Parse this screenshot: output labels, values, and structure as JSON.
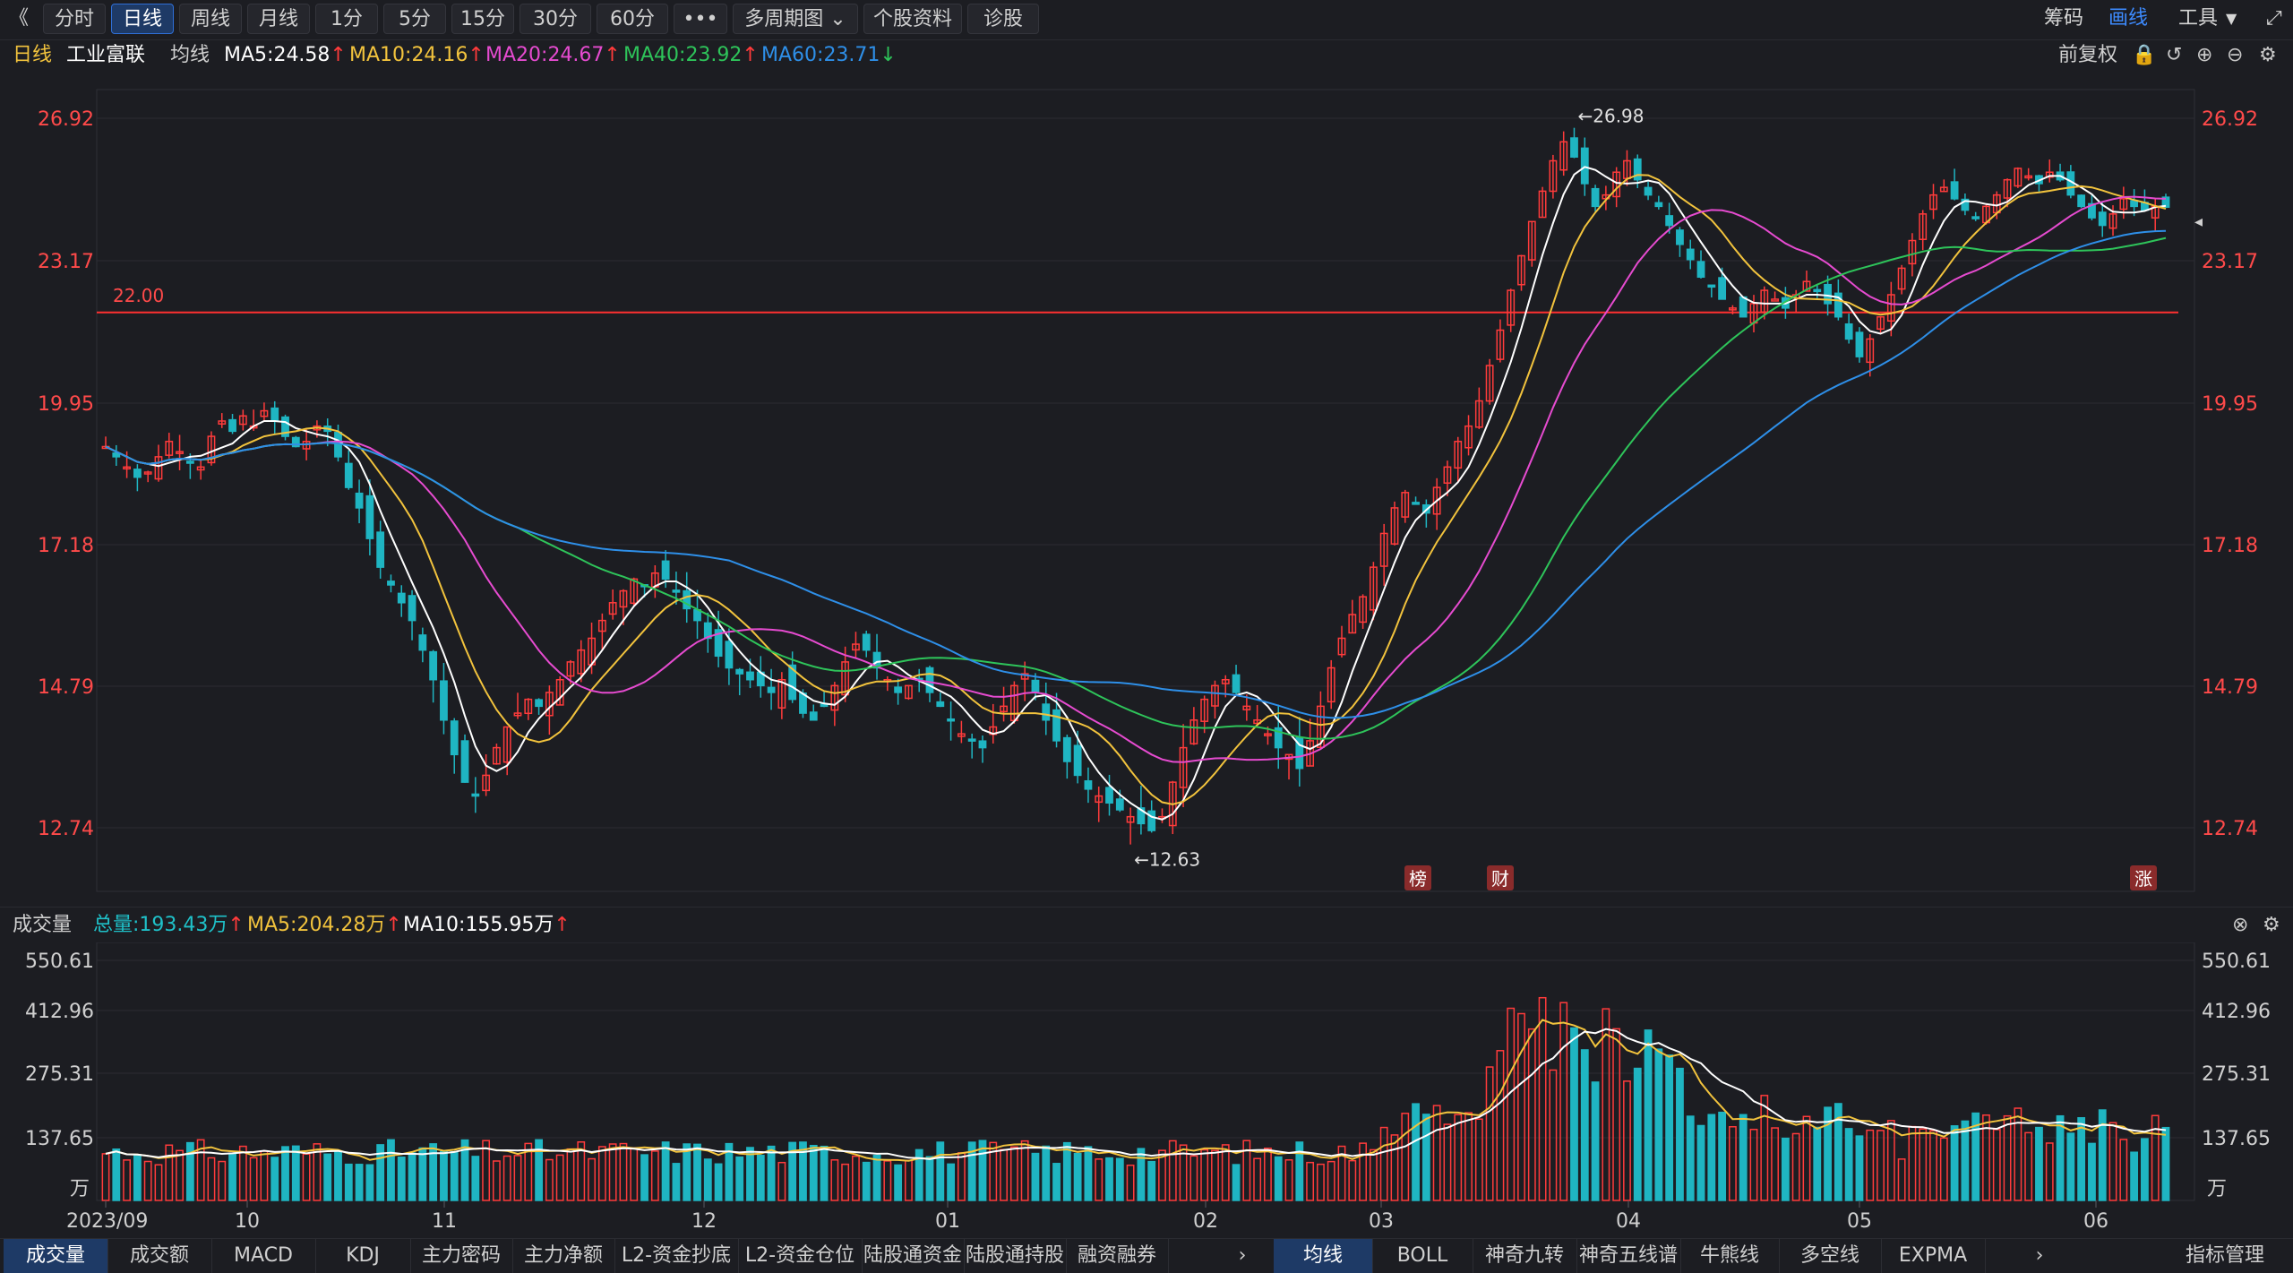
{
  "toolbar": {
    "back_icon": "《",
    "buttons": [
      "分时",
      "日线",
      "周线",
      "月线",
      "1分",
      "5分",
      "15分",
      "30分",
      "60分",
      "•••",
      "多周期图",
      "个股资料",
      "诊股"
    ],
    "active_index": 1,
    "right_items": [
      "筹码",
      "画线",
      "工具"
    ],
    "active_right": "画线"
  },
  "info": {
    "period": "日线",
    "stock_name": "工业富联",
    "ma_label": "均线",
    "ma5": "MA5:24.58",
    "ma10": "MA10:24.16",
    "ma20": "MA20:24.67",
    "ma40": "MA40:23.92",
    "ma60": "MA60:23.71",
    "adjust": "前复权"
  },
  "colors": {
    "up": "#ff3b3b",
    "down": "#1fb5c2",
    "ma5": "#ffffff",
    "ma10": "#f2c33d",
    "ma20": "#e64bd0",
    "ma40": "#2ec45a",
    "ma60": "#2e8fe8",
    "axis_red": "#ff4a4a",
    "hline": "#ff3030"
  },
  "price_axis": [
    "26.92",
    "23.17",
    "19.95",
    "17.18",
    "14.79",
    "12.74"
  ],
  "annotations": {
    "high": "←26.98",
    "low": "←12.63",
    "hline_label": "22.00",
    "markers": [
      "榜",
      "财",
      "涨"
    ]
  },
  "volume": {
    "title": "成交量",
    "total": "总量:193.43万",
    "ma5": "MA5:204.28万",
    "ma10": "MA10:155.95万",
    "axis": [
      "550.61",
      "412.96",
      "275.31",
      "137.65"
    ],
    "unit": "万"
  },
  "date_axis": [
    "2023/09",
    "10",
    "11",
    "12",
    "01",
    "02",
    "03",
    "04",
    "05",
    "06"
  ],
  "bottom_tabs_left": [
    "成交量",
    "成交额",
    "MACD",
    "KDJ",
    "主力密码",
    "主力净额",
    "L2-资金抄底",
    "L2-资金仓位",
    "陆股通资金",
    "陆股通持股",
    "融资融券"
  ],
  "bottom_tabs_mid": [
    "均线",
    "BOLL",
    "神奇九转",
    "神奇五线谱",
    "牛熊线",
    "多空线",
    "EXPMA"
  ],
  "bottom_tab_right": "指标管理",
  "chart_data": {
    "type": "candlestick",
    "symbol": "工业富联",
    "period": "daily",
    "x_range": [
      "2023/09",
      "2024/06"
    ],
    "y_ticks": [
      26.92,
      23.17,
      19.95,
      17.18,
      14.79,
      12.74
    ],
    "high_label": 26.98,
    "low_label": 12.63,
    "reference_line": 22.0,
    "ma_latest": {
      "MA5": 24.58,
      "MA10": 24.16,
      "MA20": 24.67,
      "MA40": 23.92,
      "MA60": 23.71
    },
    "close_series": [
      19.1,
      18.9,
      18.7,
      18.5,
      18.6,
      18.9,
      19.2,
      19.0,
      18.8,
      18.7,
      19.3,
      19.6,
      19.4,
      19.7,
      19.5,
      19.8,
      19.6,
      19.3,
      19.1,
      19.2,
      19.5,
      19.4,
      18.9,
      18.3,
      17.9,
      17.3,
      16.8,
      16.5,
      16.2,
      15.9,
      15.4,
      14.9,
      14.3,
      13.8,
      13.4,
      13.2,
      13.5,
      13.9,
      14.2,
      14.4,
      14.6,
      14.5,
      14.7,
      14.9,
      15.2,
      15.4,
      15.6,
      15.9,
      16.2,
      16.4,
      16.6,
      16.5,
      16.7,
      16.6,
      16.4,
      16.1,
      15.9,
      15.6,
      15.3,
      15.1,
      15.0,
      14.9,
      14.8,
      14.7,
      14.9,
      14.6,
      14.4,
      14.3,
      14.5,
      14.8,
      15.2,
      15.5,
      15.4,
      15.1,
      14.9,
      14.7,
      14.8,
      14.9,
      14.7,
      14.5,
      14.3,
      14.1,
      14.0,
      13.9,
      14.2,
      14.5,
      14.8,
      15.0,
      14.7,
      14.3,
      14.0,
      13.7,
      13.5,
      13.3,
      13.2,
      13.1,
      13.0,
      12.9,
      12.8,
      12.7,
      12.9,
      13.4,
      13.9,
      14.3,
      14.6,
      14.8,
      14.9,
      14.7,
      14.5,
      14.3,
      14.1,
      13.9,
      13.8,
      13.6,
      14.0,
      14.5,
      15.1,
      15.6,
      16.0,
      16.3,
      16.8,
      17.4,
      17.9,
      18.2,
      18.0,
      17.8,
      18.3,
      18.7,
      19.2,
      19.5,
      20.0,
      20.8,
      21.6,
      22.5,
      23.3,
      24.2,
      25.0,
      25.8,
      26.3,
      25.9,
      25.2,
      24.6,
      24.9,
      25.5,
      25.8,
      25.3,
      24.9,
      24.6,
      24.1,
      23.6,
      23.2,
      22.8,
      22.6,
      22.3,
      22.1,
      21.9,
      22.2,
      22.5,
      22.3,
      22.1,
      22.4,
      22.7,
      22.5,
      22.2,
      21.9,
      21.4,
      21.0,
      21.4,
      21.9,
      22.4,
      23.0,
      23.7,
      24.4,
      24.9,
      25.1,
      24.8,
      24.5,
      24.3,
      24.6,
      24.9,
      25.3,
      25.6,
      25.4,
      25.2,
      25.5,
      25.3,
      24.9,
      24.6,
      24.3,
      24.1,
      24.4,
      24.8,
      24.6,
      24.5,
      24.6,
      24.58
    ],
    "volume_unit": "万",
    "volume_ticks": [
      550.61,
      412.96,
      275.31,
      137.65
    ],
    "volume_total_latest": 193.43
  }
}
